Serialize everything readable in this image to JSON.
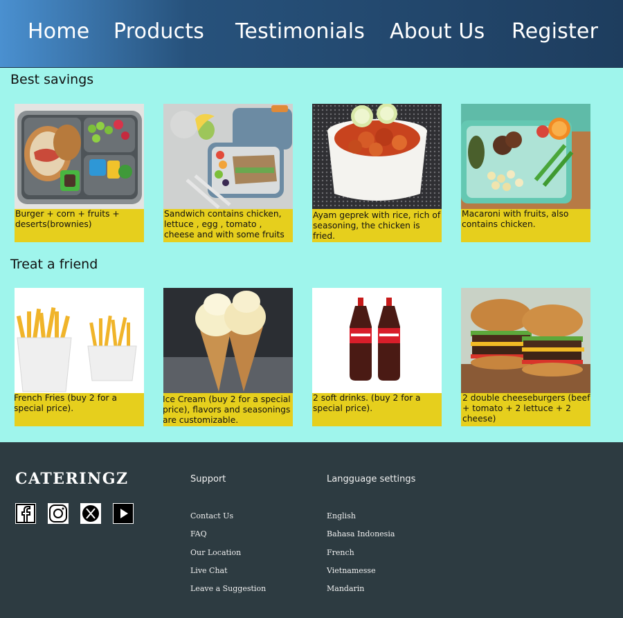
{
  "nav": {
    "items": [
      {
        "label": "Home"
      },
      {
        "label": "Products"
      },
      {
        "label": "Testimonials"
      },
      {
        "label": "About Us"
      },
      {
        "label": "Register"
      }
    ]
  },
  "sections": [
    {
      "title": "Best savings",
      "cards": [
        {
          "caption": "Burger + corn + fruits + deserts(brownies)",
          "image": "bento-lunchbox-burger"
        },
        {
          "caption": "Sandwich contains chicken, lettuce , egg , tomato , cheese and with some fruits",
          "image": "sandwich-lunchbox"
        },
        {
          "caption": "Ayam geprek with rice, rich of seasoning, the chicken is fried.",
          "image": "ayam-geprek-bowl"
        },
        {
          "caption": "Macaroni with fruits, also contains chicken.",
          "image": "macaroni-lunchbox"
        }
      ]
    },
    {
      "title": "Treat a friend",
      "cards": [
        {
          "caption": "French Fries (buy 2 for a special price).",
          "image": "french-fries"
        },
        {
          "caption": "Ice Cream (buy 2 for a special price), flavors and seasonings are customizable.",
          "image": "ice-cream-cones"
        },
        {
          "caption": "2 soft drinks. (buy 2 for a special price).",
          "image": "soft-drink-bottles"
        },
        {
          "caption": "2 double cheeseburgers (beef + tomato + 2 lettuce + 2 cheese)",
          "image": "double-cheeseburgers"
        }
      ]
    }
  ],
  "footer": {
    "brand": "CATERINGZ",
    "social": [
      "facebook-icon",
      "instagram-icon",
      "x-icon",
      "youtube-icon"
    ],
    "support": {
      "heading": "Support",
      "links": [
        "Contact Us",
        "FAQ",
        "Our Location",
        "Live Chat",
        "Leave a Suggestion"
      ]
    },
    "language": {
      "heading": "Langguage settings",
      "links": [
        "English",
        "Bahasa Indonesia",
        "French",
        "Vietnamesse",
        "Mandarin"
      ]
    }
  },
  "colors": {
    "page_bg": "#9ff5ec",
    "card_caption_bg": "#e6cf1d",
    "footer_bg": "#2d3b41",
    "nav_gradient_start": "#4a90d0",
    "nav_gradient_end": "#1e3d5e"
  }
}
